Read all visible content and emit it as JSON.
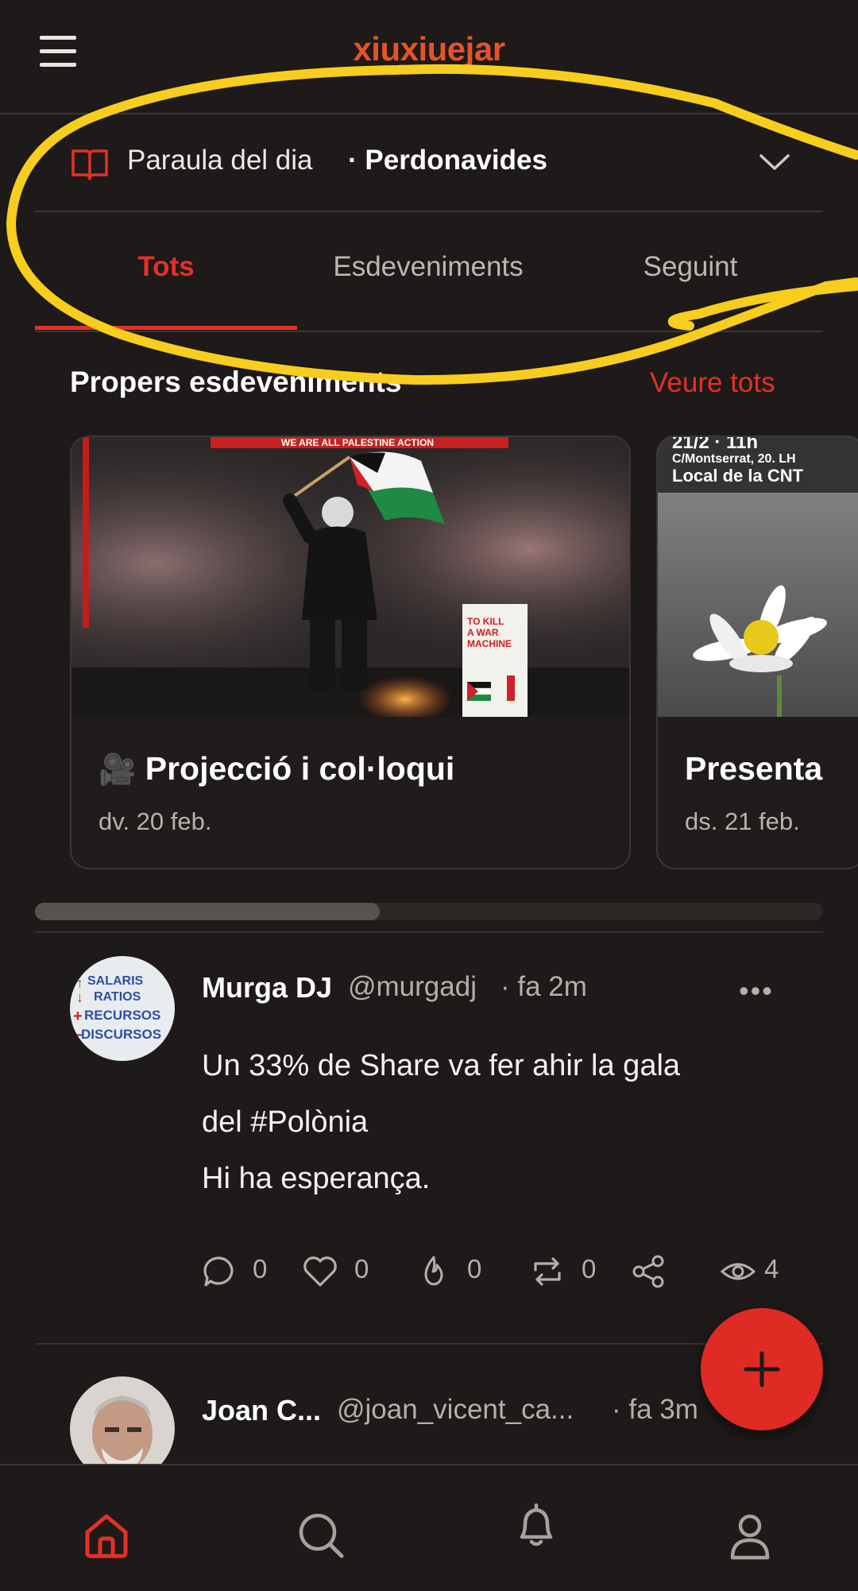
{
  "header": {
    "app_name": "xiuxiuejar"
  },
  "word_of_day": {
    "label": "Paraula del dia",
    "word": "· Perdonavides"
  },
  "tabs": [
    {
      "label": "Tots",
      "active": true
    },
    {
      "label": "Esdeveniments",
      "active": false
    },
    {
      "label": "Seguint",
      "active": false
    }
  ],
  "events": {
    "title": "Propers esdeveniments",
    "see_all": "Veure tots",
    "cards": [
      {
        "title": "Projecció i col·loqui",
        "date": "dv. 20 feb.",
        "poster_banner": "WE ARE ALL PALESTINE ACTION",
        "poster_book": "TO KILL A WAR MACHINE"
      },
      {
        "title": "Presenta",
        "date": "ds. 21 feb.",
        "poster_line1": "21/2 · 11h",
        "poster_line2": "C/Montserrat, 20. LH",
        "poster_line3": "Local de la CNT"
      }
    ]
  },
  "posts": [
    {
      "name": "Murga DJ",
      "handle": "@murgadj",
      "time": "· fa 2m",
      "more": "•••",
      "avatar_text": [
        "SALARIS",
        "RATIOS",
        "RECURSOS",
        "DISCURSOS"
      ],
      "lines": [
        "Un 33% de Share va fer ahir la gala",
        "del #Polònia",
        "Hi ha esperança."
      ],
      "stats": {
        "comments": "0",
        "likes": "0",
        "fire": "0",
        "reposts": "0",
        "views": "4"
      }
    },
    {
      "name": "Joan C...",
      "handle": "@joan_vicent_ca...",
      "time": "· fa 3m"
    }
  ],
  "colors": {
    "background": "#1d1a19",
    "accent_red": "#e53027",
    "logo_orange": "#e4532a",
    "annotation_yellow": "#f7cd1e"
  },
  "icons": {
    "menu": "hamburger-icon",
    "wotd": "book-icon",
    "expand": "chevron-down-icon",
    "fab": "plus-icon",
    "nav": [
      "home-icon",
      "search-icon",
      "bell-icon",
      "user-icon"
    ]
  }
}
